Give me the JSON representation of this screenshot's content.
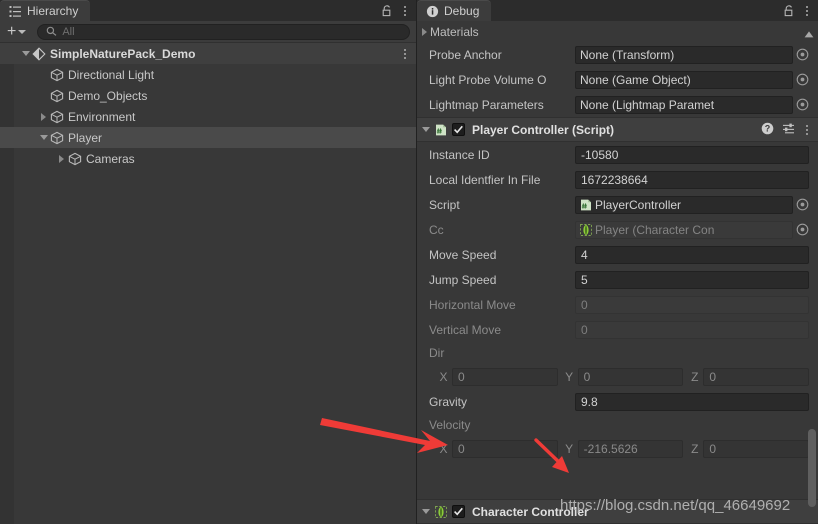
{
  "hierarchy": {
    "tab": {
      "label": "Hierarchy",
      "icon": "hierarchy-list-icon"
    },
    "lock_icon": "unlocked-padlock-icon",
    "menu_icon": "kebab-menu-icon",
    "toolbar": {
      "add_label": "+",
      "add_dropdown_icon": "chevron-down-icon",
      "search_icon": "search-icon",
      "search_placeholder": "All",
      "search_value": ""
    },
    "items": [
      {
        "label": "SimpleNaturePack_Demo",
        "depth": 0,
        "icon": "scene-icon",
        "fold": "down",
        "selected": false,
        "root": true,
        "kebab": true
      },
      {
        "label": "Directional Light",
        "depth": 1,
        "icon": "gameobject-icon",
        "fold": "none",
        "selected": false,
        "root": false,
        "kebab": false
      },
      {
        "label": "Demo_Objects",
        "depth": 1,
        "icon": "gameobject-icon",
        "fold": "none",
        "selected": false,
        "root": false,
        "kebab": false
      },
      {
        "label": "Environment",
        "depth": 1,
        "icon": "gameobject-icon",
        "fold": "right",
        "selected": false,
        "root": false,
        "kebab": false
      },
      {
        "label": "Player",
        "depth": 1,
        "icon": "gameobject-icon",
        "fold": "down",
        "selected": true,
        "root": false,
        "kebab": false
      },
      {
        "label": "Cameras",
        "depth": 2,
        "icon": "gameobject-icon",
        "fold": "right",
        "selected": false,
        "root": false,
        "kebab": false
      }
    ]
  },
  "inspector": {
    "tab": {
      "label": "Debug",
      "icon": "info-circle-icon"
    },
    "lock_icon": "unlocked-padlock-icon",
    "menu_icon": "kebab-menu-icon",
    "materials_foldout": {
      "label": "Materials",
      "fold": "right"
    },
    "renderer_rows": [
      {
        "label": "Probe Anchor",
        "value": "None (Transform)",
        "dim": false,
        "type": "object"
      },
      {
        "label": "Light Probe Volume O",
        "value": "None (Game Object)",
        "dim": false,
        "type": "object"
      },
      {
        "label": "Lightmap Parameters",
        "value": "None (Lightmap Paramet",
        "dim": false,
        "type": "object"
      }
    ],
    "component": {
      "title": "Player Controller (Script)",
      "script_icon": "csharp-script-icon",
      "enabled": true,
      "fold": "down",
      "help_icon": "help-circle-icon",
      "preset_icon": "preset-sliders-icon",
      "menu_icon": "kebab-menu-icon"
    },
    "rows": [
      {
        "kind": "text",
        "label": "Instance ID",
        "value": "-10580",
        "dim": false
      },
      {
        "kind": "text",
        "label": "Local Identfier In File",
        "value": "1672238664",
        "dim": false
      },
      {
        "kind": "object",
        "label": "Script",
        "value": "PlayerController",
        "icon": "csharp-script-icon",
        "dim": false
      },
      {
        "kind": "object",
        "label": "Cc",
        "value": "Player (Character Con",
        "icon": "character-controller-icon",
        "dim": true
      },
      {
        "kind": "text",
        "label": "Move Speed",
        "value": "4",
        "dim": false
      },
      {
        "kind": "text",
        "label": "Jump Speed",
        "value": "5",
        "dim": false
      },
      {
        "kind": "text",
        "label": "Horizontal Move",
        "value": "0",
        "dim": true
      },
      {
        "kind": "text",
        "label": "Vertical Move",
        "value": "0",
        "dim": true
      },
      {
        "kind": "vecLabel",
        "label": "Dir"
      },
      {
        "kind": "vector",
        "x": "0",
        "y": "0",
        "z": "0",
        "ax": "X",
        "ay": "Y",
        "az": "Z"
      },
      {
        "kind": "text",
        "label": "Gravity",
        "value": "9.8",
        "dim": false
      },
      {
        "kind": "vecLabel",
        "label": "Velocity"
      },
      {
        "kind": "vector",
        "x": "0",
        "y": "-216.5626",
        "z": "0",
        "ax": "X",
        "ay": "Y",
        "az": "Z"
      }
    ],
    "next_component": {
      "title": "Character Controller",
      "icon": "character-controller-icon",
      "enabled": true,
      "fold": "down"
    },
    "scroll_up_icon": "scroll-up-arrow-icon"
  },
  "annotations": {
    "arrow_color": "#ef3b37",
    "big_arrow": "points-at-velocity-label",
    "small_arrow": "points-at-velocity-y-field",
    "watermark": "https://blog.csdn.net/qq_46649692"
  },
  "colors": {
    "panel_bg": "#383838",
    "tabbar_bg": "#2c2c2c",
    "tab_active": "#3c3c3c",
    "field_bg": "#2a2a2a",
    "selection": "#4a4a4a",
    "text": "#c4c4c4",
    "text_dim": "#8b8b8b",
    "accent_red": "#ef3b37"
  }
}
